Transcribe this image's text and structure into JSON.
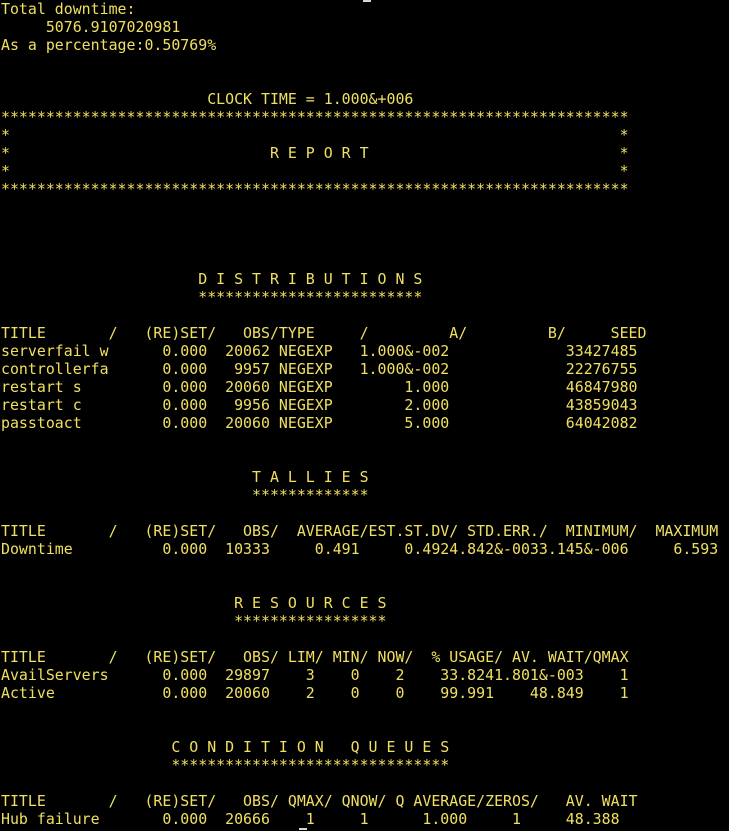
{
  "window": {
    "text_color": "#f0e060",
    "background_color": "#000000"
  },
  "terminal": {
    "lines": [
      "Total downtime:",
      "     5076.9107020981",
      "As a percentage:0.50769%",
      "",
      "",
      "                       CLOCK TIME = 1.000&+006",
      "**********************************************************************",
      "*                                                                    *",
      "*                             R E P O R T                            *",
      "*                                                                    *",
      "**********************************************************************",
      "",
      "",
      "",
      "",
      "                      D I S T R I B U T I O N S",
      "                      *************************",
      "",
      "TITLE       /   (RE)SET/   OBS/TYPE     /         A/         B/     SEED",
      "serverfail w      0.000  20062 NEGEXP   1.000&-002             33427485",
      "controllerfa      0.000   9957 NEGEXP   1.000&-002             22276755",
      "restart s         0.000  20060 NEGEXP        1.000             46847980",
      "restart c         0.000   9956 NEGEXP        2.000             43859043",
      "passtoact         0.000  20060 NEGEXP        5.000             64042082",
      "",
      "",
      "                            T A L L I E S",
      "                            *************",
      "",
      "TITLE       /   (RE)SET/   OBS/  AVERAGE/EST.ST.DV/ STD.ERR./  MINIMUM/  MAXIMUM",
      "Downtime          0.000  10333     0.491     0.4924.842&-0033.145&-006     6.593",
      "",
      "",
      "                          R E S O U R C E S",
      "                          *****************",
      "",
      "TITLE       /   (RE)SET/   OBS/ LIM/ MIN/ NOW/  % USAGE/ AV. WAIT/QMAX",
      "AvailServers      0.000  29897    3    0    2    33.8241.801&-003    1",
      "Active            0.000  20060    2    0    0    99.991    48.849    1",
      "",
      "",
      "                   C O N D I T I O N   Q U E U E S",
      "                   *******************************",
      "",
      "TITLE       /   (RE)SET/   OBS/ QMAX/ QNOW/ Q AVERAGE/ZEROS/   AV. WAIT",
      "Hub failure       0.000  20666    1     1      1.000     1     48.388"
    ]
  }
}
